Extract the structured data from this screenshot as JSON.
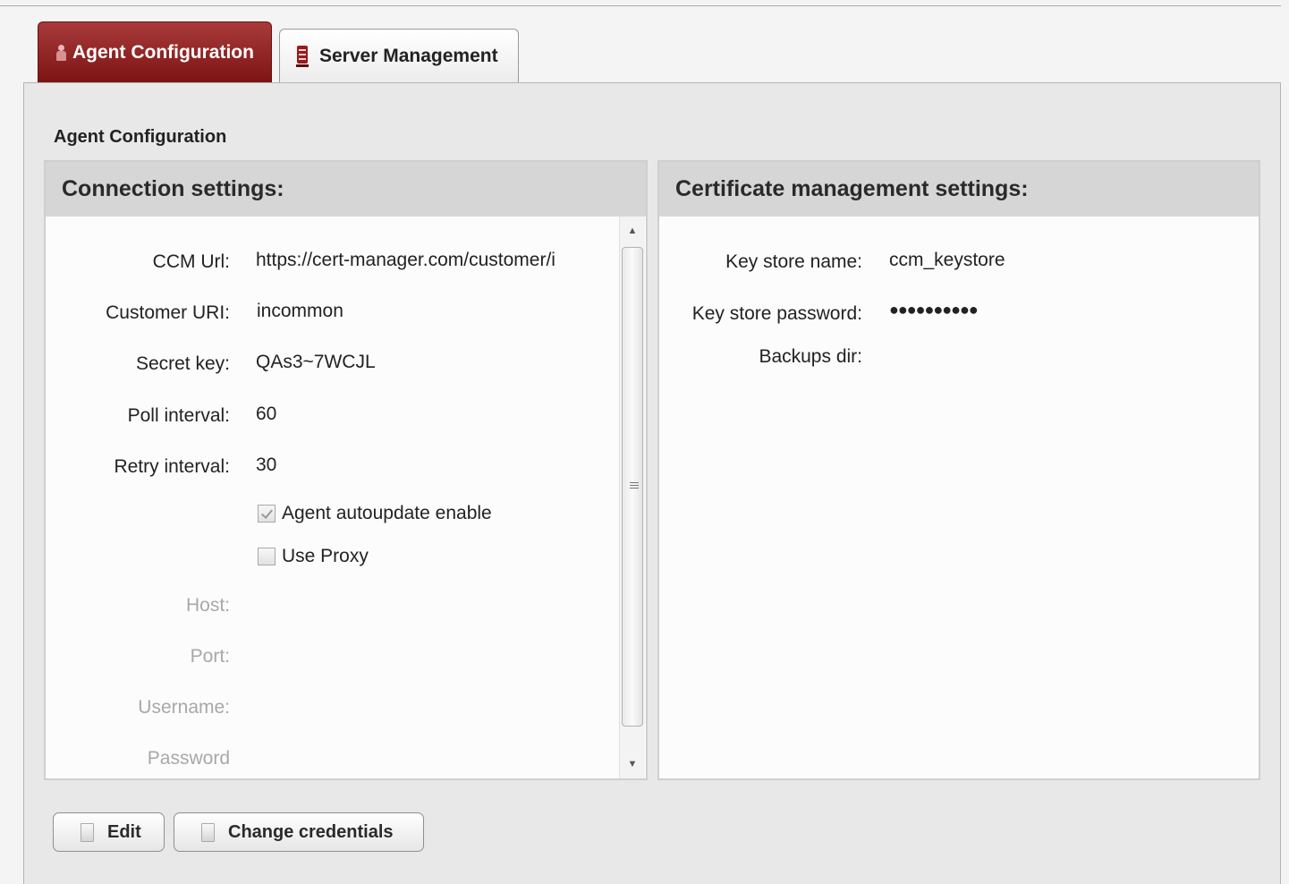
{
  "tabs": {
    "agent_configuration": {
      "label": "Agent Configuration",
      "icon": "agent-icon",
      "active": true
    },
    "server_management": {
      "label": "Server Management",
      "icon": "server-icon",
      "active": false
    }
  },
  "section_title": "Agent Configuration",
  "connection": {
    "header": "Connection settings:",
    "fields": {
      "ccm_url": {
        "label": "CCM Url:",
        "value": "https://cert-manager.com/customer/i"
      },
      "customer_uri": {
        "label": "Customer URI:",
        "value": "incommon"
      },
      "secret_key": {
        "label": "Secret key:",
        "value": "QAs3~7WCJL"
      },
      "poll_interval": {
        "label": "Poll interval:",
        "value": "60"
      },
      "retry_interval": {
        "label": "Retry interval:",
        "value": "30"
      }
    },
    "autoupdate": {
      "label": "Agent autoupdate enable",
      "checked": true
    },
    "use_proxy": {
      "label": "Use Proxy",
      "checked": false
    },
    "proxy_fields": {
      "host": "Host:",
      "port": "Port:",
      "username": "Username:",
      "password": "Password"
    }
  },
  "certificate": {
    "header": "Certificate management settings:",
    "fields": {
      "key_store_name": {
        "label": "Key store name:",
        "value": "ccm_keystore"
      },
      "key_store_password": {
        "label": "Key store password:",
        "value": "●●●●●●●●●●"
      },
      "backups_dir": {
        "label": "Backups dir:",
        "value": ""
      }
    }
  },
  "buttons": {
    "edit": "Edit",
    "change_credentials": "Change credentials"
  },
  "colors": {
    "active_tab": "#8b1c1c",
    "panel_bg": "#e8e8e8",
    "group_header_bg": "#d6d6d6",
    "disabled_text": "#a8a8a8"
  }
}
